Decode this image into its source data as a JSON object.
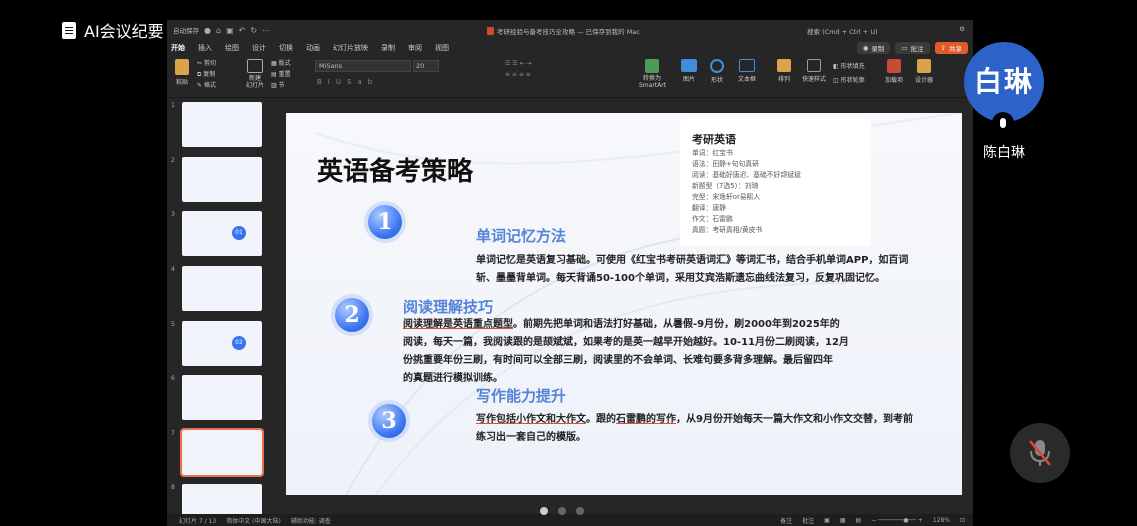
{
  "meeting": {
    "title": "AI会议纪要",
    "participant_initials": "白琳",
    "participant_name": "陈白琳"
  },
  "app": {
    "autosave": "自动保存",
    "doc_title": "考研经验与备考技巧全攻略 — 已保存到我的 Mac",
    "search": "搜索 (Cmd + Ctrl + U)",
    "menu": [
      "开始",
      "插入",
      "绘图",
      "设计",
      "切换",
      "动画",
      "幻灯片放映",
      "录制",
      "审阅",
      "视图"
    ],
    "btn_record": "录制",
    "btn_comment": "批注",
    "btn_share": "共享",
    "ribbon": {
      "paste": "粘贴",
      "cut": "剪切",
      "copy": "复制",
      "format": "格式",
      "new_slide": "新建\n幻灯片",
      "layout": "版式",
      "reset": "重置",
      "section": "节",
      "font": "MiSans",
      "size": "20",
      "smartart": "转换为\nSmartArt",
      "picture": "图片",
      "shape": "形状",
      "textbox": "文本框",
      "arrange": "排列",
      "quick_style": "快速样式",
      "shape_fill": "形状填充",
      "shape_outline": "形状轮廓",
      "addin": "加载项",
      "designer": "设计器"
    },
    "status": {
      "slide": "幻灯片 7 / 13",
      "lang": "简体中文 (中国大陆)",
      "access": "辅助功能: 调查",
      "notes": "备注",
      "comments": "批注",
      "zoom": "128%"
    }
  },
  "thumbnails": [
    {
      "n": "1"
    },
    {
      "n": "2"
    },
    {
      "n": "3",
      "badge": "01"
    },
    {
      "n": "4"
    },
    {
      "n": "5",
      "badge": "02"
    },
    {
      "n": "6"
    },
    {
      "n": "7"
    },
    {
      "n": "8"
    }
  ],
  "slide": {
    "title": "英语备考策略",
    "card": {
      "heading": "考研英语",
      "lines": [
        "单词：红宝书",
        "语法：田静+句句真研",
        "阅读：基础好唐迟、基础不好颉斌斌",
        "新题型（7选5）：刘琦",
        "完型：宋逸轩or易熙人",
        "翻译：唐静",
        "作文：石雷鹏",
        "真题：考研真相/黄皮书"
      ]
    },
    "sections": [
      {
        "num": "1",
        "heading": "单词记忆方法",
        "text": [
          "单词记忆是英语复习基础。可使用《红宝书考研英语词汇》等词汇书，结合手机单词APP，如百词",
          "斩、墨墨背单词。每天背诵50-100个单词，采用艾宾浩斯遗忘曲线法复习，反复巩固记忆。"
        ]
      },
      {
        "num": "2",
        "heading": "阅读理解技巧",
        "lead": "阅读理解是英语重点题型",
        "text": [
          "。前期先把单词和语法打好基础，从暑假-9月份，刷2000年到2025年的",
          "阅读，每天一篇，我阅读跟的是颉斌斌，如果考的是英一越早开始越好。10-11月份二刷阅读，12月",
          "份挑重要年份三刷，有时间可以全部三刷，阅读里的不会单词、长难句要多背多理解。最后留四年",
          "的真题进行模拟训练。"
        ]
      },
      {
        "num": "3",
        "heading": "写作能力提升",
        "lead": "写作包括小作文和大作文",
        "text": [
          "。跟的",
          "石雷鹏的写作",
          "，从9月份开始每天一篇大作文和小作文交替，到考前",
          "练习出一套自己的模版。"
        ]
      }
    ]
  },
  "colors": {
    "accent": "#5583d8",
    "share": "#e05a2a",
    "avatar": "#2d63c8",
    "selected": "#e8734a"
  }
}
